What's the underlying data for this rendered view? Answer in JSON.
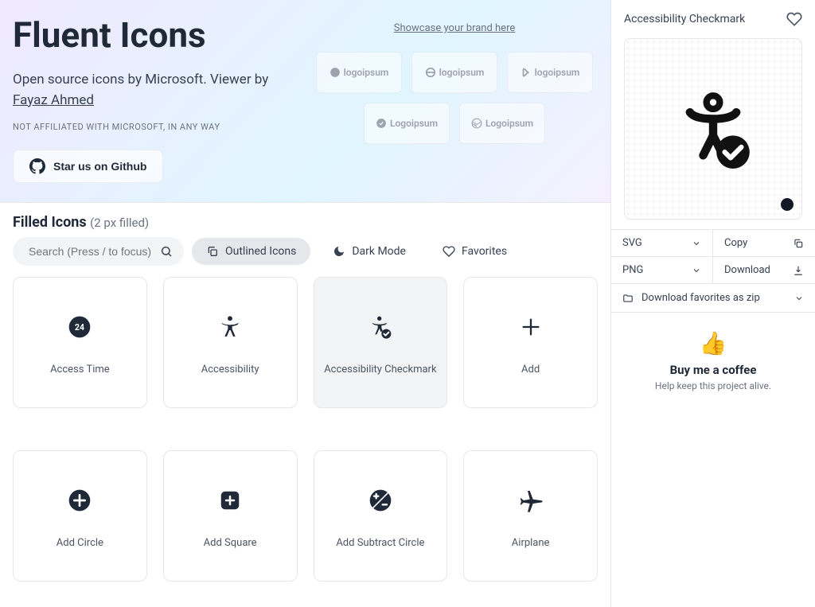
{
  "hero": {
    "title": "Fluent Icons",
    "subtitle_prefix": "Open source icons by Microsoft. Viewer by ",
    "author": "Fayaz Ahmed",
    "note": "NOT AFFILIATED WITH MICROSOFT, IN ANY WAY",
    "github_label": "Star us on Github",
    "showcase_label": "Showcase your brand here",
    "sponsors": [
      "logoipsum",
      "logoipsum",
      "logoipsum",
      "Logoipsum",
      "Logoipsum"
    ]
  },
  "section": {
    "title": "Filled Icons ",
    "subtitle": "(2 px filled)"
  },
  "toolbar": {
    "search_placeholder": "Search (Press / to focus)",
    "outlined_label": "Outlined Icons",
    "dark_label": "Dark Mode",
    "favorites_label": "Favorites"
  },
  "icons": [
    {
      "label": "Access Time",
      "name": "access-time"
    },
    {
      "label": "Accessibility",
      "name": "accessibility"
    },
    {
      "label": "Accessibility Checkmark",
      "name": "accessibility-checkmark",
      "selected": true
    },
    {
      "label": "Add",
      "name": "add"
    },
    {
      "label": "Add Circle",
      "name": "add-circle"
    },
    {
      "label": "Add Square",
      "name": "add-square"
    },
    {
      "label": "Add Subtract Circle",
      "name": "add-subtract-circle"
    },
    {
      "label": "Airplane",
      "name": "airplane"
    }
  ],
  "sidebar": {
    "selected_name": "Accessibility Checkmark",
    "svg_label": "SVG",
    "copy_label": "Copy",
    "png_label": "PNG",
    "download_label": "Download",
    "zip_label": "Download favorites as zip",
    "coffee_title": "Buy me a coffee",
    "coffee_sub": "Help keep this project alive."
  }
}
